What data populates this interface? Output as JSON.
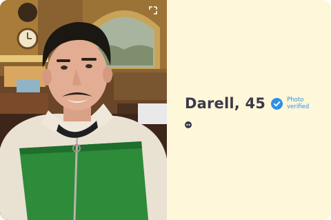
{
  "profile": {
    "name_age": "Darell, 45",
    "verified_label": "Photo verified"
  },
  "icons": {
    "expand": "expand-icon",
    "verified": "verified-check-icon",
    "quote": "quote-icon"
  },
  "colors": {
    "card_background": "#fff7d9",
    "verified_blue": "#2e8fe8",
    "name_text": "#3a3a4a"
  }
}
